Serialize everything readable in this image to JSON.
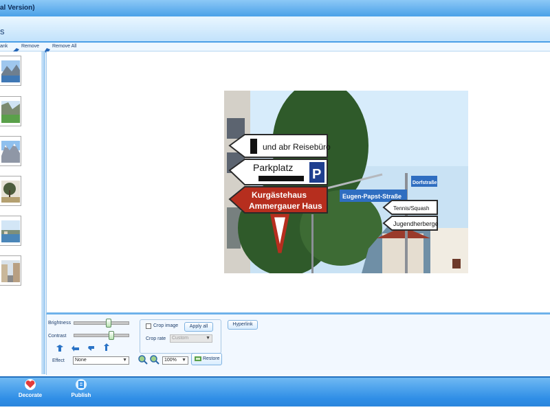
{
  "window": {
    "title": "al Version)"
  },
  "header": {
    "title": "s"
  },
  "toolbar": {
    "blank_label": "ank",
    "remove_label": "Remove",
    "remove_all_label": "Remove All"
  },
  "photo": {
    "signs": [
      "und abr Reisebüro",
      "Parkplatz",
      "P",
      "Kurgästehaus",
      "Ammergauer Haus",
      "Eugen-Papst-Straße",
      "Dorfstraße",
      "Tennis/Squash",
      "Jugendherberge"
    ]
  },
  "controls": {
    "brightness_label": "Brightness",
    "brightness_value": 0.65,
    "contrast_label": "Contrast",
    "contrast_value": 0.7,
    "effect_label": "Effect",
    "effect_value": "None",
    "crop_image_label": "Crop image",
    "apply_all_label": "Apply all",
    "crop_rate_label": "Crop rate",
    "crop_rate_value": "Custom",
    "zoom_value": "100%",
    "restore_label": "Restore",
    "hyperlink_label": "Hyperlink"
  },
  "bottombar": {
    "decorate_label": "Decorate",
    "publish_label": "Publish"
  },
  "colors": {
    "accent": "#2f8ee6",
    "titlebar": "#4aa1e8"
  }
}
